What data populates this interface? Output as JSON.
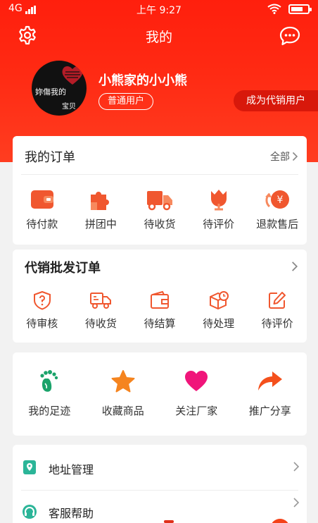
{
  "status_bar": {
    "network": "4G",
    "time": "上午 9:27"
  },
  "header": {
    "title": "我的"
  },
  "profile": {
    "avatar_text_line1": "妳傷我的",
    "avatar_text_line2": "宝贝",
    "nickname": "小熊家的小小熊",
    "user_type": "普通用户",
    "become_distributor": "成为代销用户"
  },
  "orders": {
    "title": "我的订单",
    "see_all": "全部",
    "items": [
      {
        "label": "待付款",
        "icon": "wallet-icon"
      },
      {
        "label": "拼团中",
        "icon": "puzzle-icon"
      },
      {
        "label": "待收货",
        "icon": "truck-icon"
      },
      {
        "label": "待评价",
        "icon": "flower-icon"
      },
      {
        "label": "退款售后",
        "icon": "yen-refund-icon"
      }
    ]
  },
  "distribution": {
    "title": "代销批发订单",
    "items": [
      {
        "label": "待审核",
        "icon": "shield-question-icon"
      },
      {
        "label": "待收货",
        "icon": "truck-outline-icon"
      },
      {
        "label": "待结算",
        "icon": "wallet-outline-icon"
      },
      {
        "label": "待处理",
        "icon": "box-clock-icon"
      },
      {
        "label": "待评价",
        "icon": "edit-icon"
      }
    ]
  },
  "quick": {
    "items": [
      {
        "label": "我的足迹",
        "icon": "footprint-icon"
      },
      {
        "label": "收藏商品",
        "icon": "star-icon"
      },
      {
        "label": "关注厂家",
        "icon": "heart-icon"
      },
      {
        "label": "推广分享",
        "icon": "share-arrow-icon"
      }
    ]
  },
  "menu": {
    "items": [
      {
        "label": "地址管理",
        "icon": "location-book-icon"
      },
      {
        "label": "客服帮助",
        "icon": "headset-icon"
      }
    ]
  },
  "colors": {
    "header_red": "#ff2a13",
    "accent_orange": "#f0572f",
    "footprint_green": "#1aa36a",
    "star_orange": "#f5841f",
    "heart_pink": "#f0157a",
    "share_orange": "#f4501c",
    "menu_teal": "#2bb598"
  }
}
